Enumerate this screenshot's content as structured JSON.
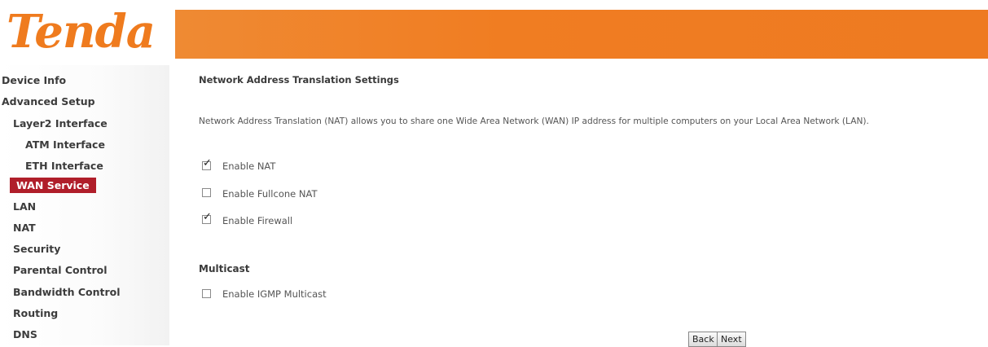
{
  "header": {
    "logo_text": "Tenda",
    "brand_color": "#ef7b1e"
  },
  "sidebar": {
    "items": [
      {
        "label": "Device Info"
      },
      {
        "label": "Advanced Setup"
      },
      {
        "label": "Layer2 Interface"
      },
      {
        "label": "ATM Interface"
      },
      {
        "label": "ETH Interface"
      },
      {
        "label": "WAN Service",
        "active": true
      },
      {
        "label": "LAN"
      },
      {
        "label": "NAT"
      },
      {
        "label": "Security"
      },
      {
        "label": "Parental Control"
      },
      {
        "label": "Bandwidth Control"
      },
      {
        "label": "Routing"
      },
      {
        "label": "DNS"
      }
    ],
    "active_color": "#b01e2a"
  },
  "main": {
    "title": "Network Address Translation Settings",
    "description": "Network Address Translation (NAT) allows you to share one Wide Area Network (WAN) IP address for multiple computers on your Local Area Network (LAN).",
    "options": [
      {
        "label": "Enable NAT",
        "checked": true
      },
      {
        "label": "Enable Fullcone NAT",
        "checked": false
      },
      {
        "label": "Enable Firewall",
        "checked": true
      }
    ],
    "multicast": {
      "heading": "Multicast",
      "option": {
        "label": "Enable IGMP Multicast",
        "checked": false
      }
    },
    "buttons": {
      "back": "Back",
      "next": "Next"
    }
  }
}
